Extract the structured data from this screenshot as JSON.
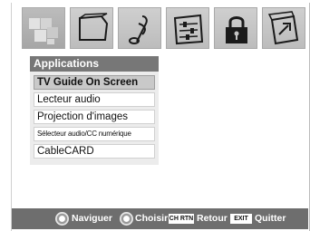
{
  "menu": {
    "tabs": [
      {
        "name": "applications",
        "icon": "apps-icon",
        "active": true
      },
      {
        "name": "picture",
        "icon": "picture-icon",
        "active": false
      },
      {
        "name": "audio",
        "icon": "music-note-icon",
        "active": false
      },
      {
        "name": "preferences",
        "icon": "sliders-icon",
        "active": false
      },
      {
        "name": "locks",
        "icon": "lock-icon",
        "active": false
      },
      {
        "name": "setup",
        "icon": "setup-icon",
        "active": false
      }
    ],
    "panel_title": "Applications",
    "items": [
      "TV Guide On Screen",
      "Lecteur audio",
      "Projection d'images",
      "Sélecteur audio/CC numérique",
      "CableCARD"
    ],
    "selected_index": 0
  },
  "footer": {
    "navigate": "Naviguer",
    "select": "Choisir",
    "back_key": "CH RTN",
    "back": "Retour",
    "exit_key": "EXIT",
    "exit": "Quitter"
  },
  "colors": {
    "panel_title_bg": "#777777",
    "footer_bg": "#6e6e6e",
    "selected_item_bg": "#c9c9c9"
  }
}
